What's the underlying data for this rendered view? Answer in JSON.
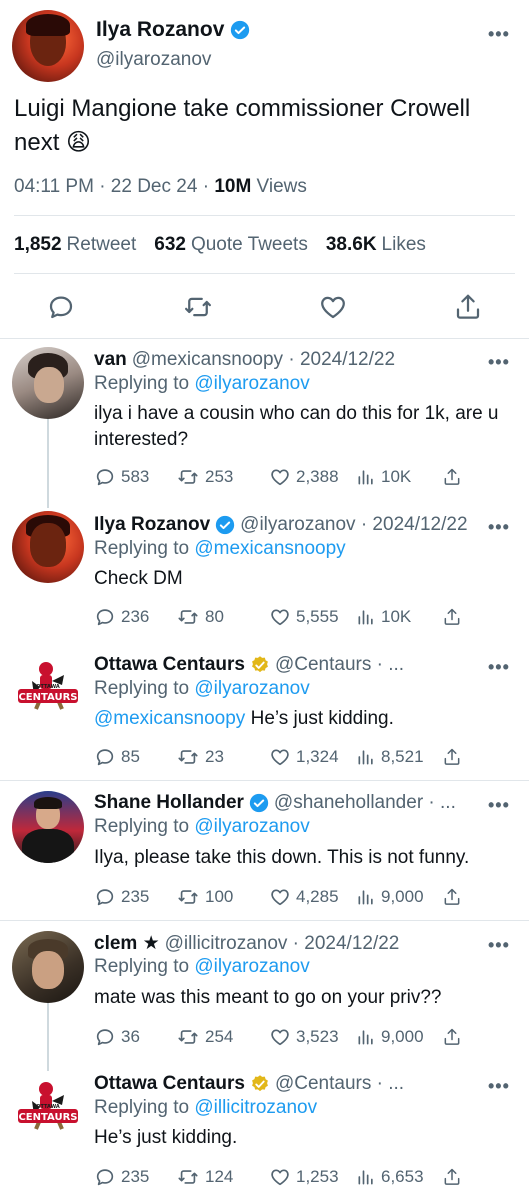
{
  "main_tweet": {
    "name": "Ilya Rozanov",
    "handle": "@ilyarozanov",
    "text": "Luigi Mangione take commissioner Crowell next 😩",
    "time": "04:11 PM · 22 Dec 24 · ",
    "views_count": "10M",
    "views_label": " Views",
    "retweets_count": "1,852",
    "retweets_label": "Retweet",
    "quotes_count": "632",
    "quotes_label": "Quote Tweets",
    "likes_count": "38.6K",
    "likes_label": "Likes"
  },
  "replies": [
    {
      "name": "van",
      "handle": "@mexicansnoopy · 2024/12/22",
      "replying_label": "Replying to ",
      "replying_to": "@ilyarozanov",
      "mention": "",
      "text": "ilya i have a cousin who can do this for 1k, are u interested?",
      "replies": "583",
      "retweets": "253",
      "likes": "2,388",
      "views": "10K"
    },
    {
      "name": "Ilya Rozanov",
      "handle": "@ilyarozanov · 2024/12/22",
      "replying_label": "Replying to ",
      "replying_to": "@mexicansnoopy",
      "mention": "",
      "text": "Check DM",
      "replies": "236",
      "retweets": "80",
      "likes": "5,555",
      "views": "10K"
    },
    {
      "name": "Ottawa Centaurs",
      "handle": "@Centaurs · ...",
      "replying_label": "Replying to ",
      "replying_to": "@ilyarozanov",
      "mention": "@mexicansnoopy",
      "text": " He’s just kidding.",
      "replies": "85",
      "retweets": "23",
      "likes": "1,324",
      "views": "8,521"
    },
    {
      "name": "Shane Hollander",
      "handle": "@shanehollander · ...",
      "replying_label": "Replying to ",
      "replying_to": "@ilyarozanov",
      "mention": "",
      "text": "Ilya, please take this down. This is not funny.",
      "replies": "235",
      "retweets": "100",
      "likes": "4,285",
      "views": "9,000"
    },
    {
      "name": "clem ★",
      "handle": "@illicitrozanov · 2024/12/22",
      "replying_label": "Replying to ",
      "replying_to": "@ilyarozanov",
      "mention": "",
      "text": "mate was this meant to go on your priv??",
      "replies": "36",
      "retweets": "254",
      "likes": "3,523",
      "views": "9,000"
    },
    {
      "name": "Ottawa Centaurs",
      "handle": "@Centaurs · ...",
      "replying_label": "Replying to ",
      "replying_to": "@illicitrozanov",
      "mention": "",
      "text": "He’s just kidding.",
      "replies": "235",
      "retweets": "124",
      "likes": "1,253",
      "views": "6,653"
    }
  ],
  "logo_text": "CENTAURS",
  "logo_subtext": "OTTAWA",
  "colors": {
    "link": "#1d9bf0",
    "secondary_text": "#536471",
    "verified_blue": "#1d9bf0",
    "verified_gold": "#e2b719",
    "divider": "#e1e6ea"
  }
}
